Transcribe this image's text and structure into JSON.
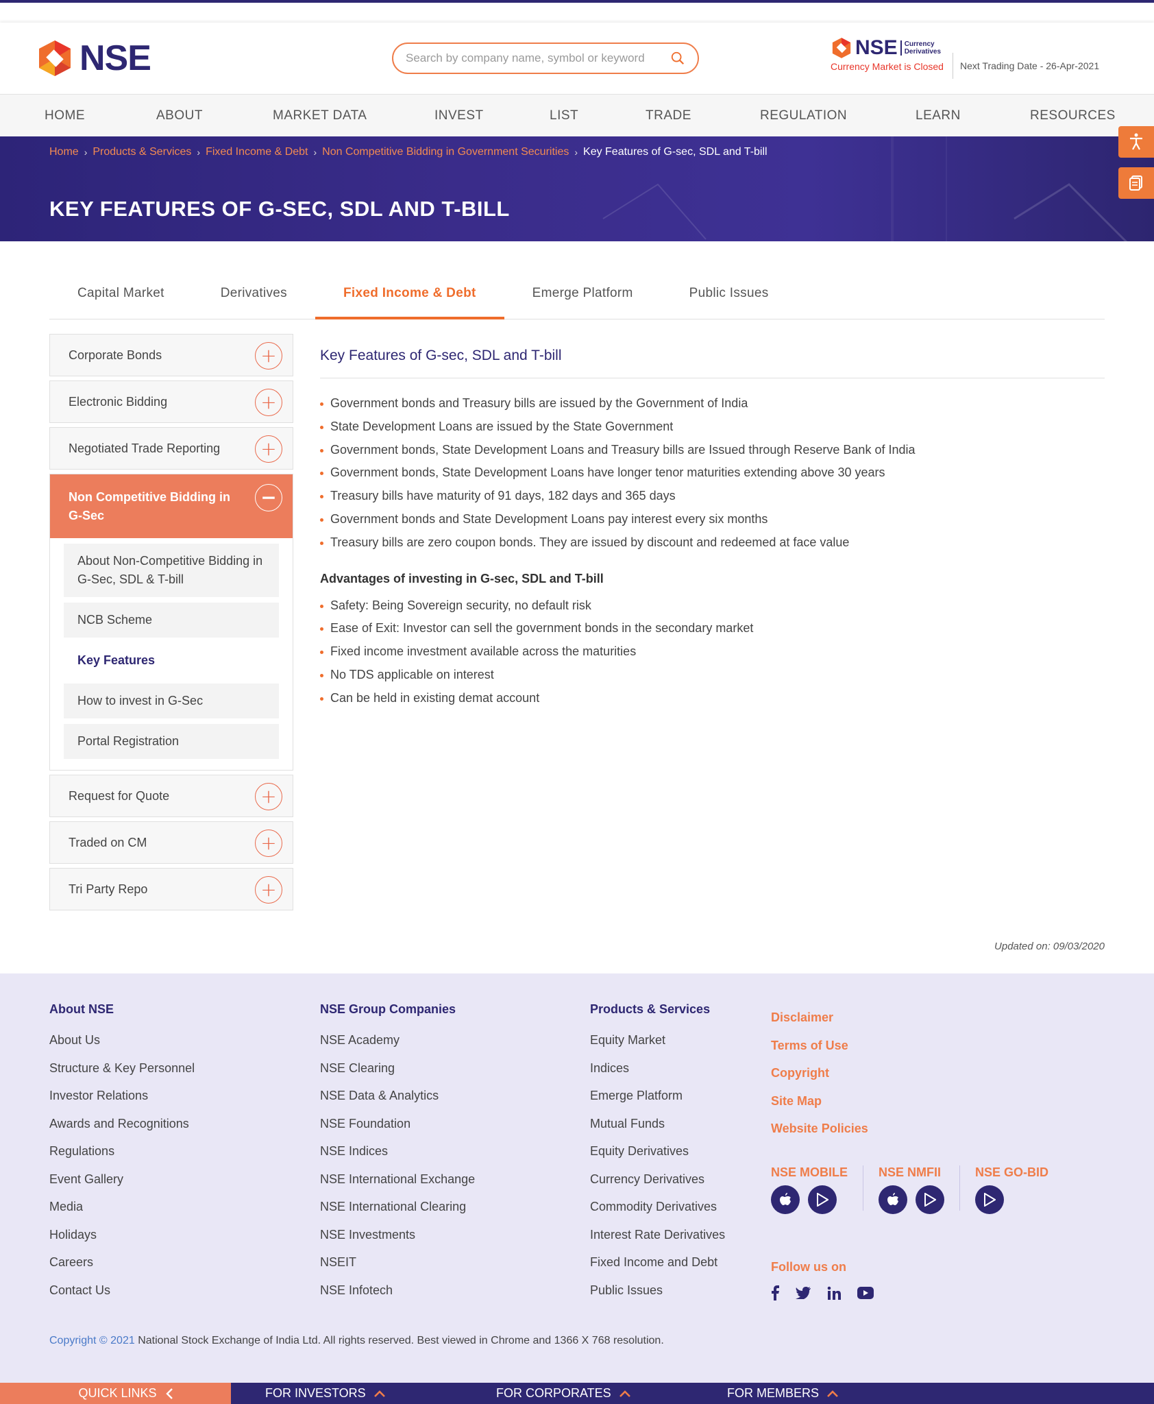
{
  "header": {
    "logo_text": "NSE",
    "search_placeholder": "Search by company name, symbol or keyword",
    "cd_logo": "NSE",
    "cd_sub_1": "Currency",
    "cd_sub_2": "Derivatives",
    "cd_status": "Currency Market is Closed",
    "trade_date": "Next Trading Date - 26-Apr-2021"
  },
  "nav": [
    "HOME",
    "ABOUT",
    "MARKET DATA",
    "INVEST",
    "LIST",
    "TRADE",
    "REGULATION",
    "LEARN",
    "RESOURCES"
  ],
  "breadcrumb": {
    "items": [
      "Home",
      "Products & Services",
      "Fixed Income & Debt",
      "Non Competitive Bidding in Government Securities"
    ],
    "current": "Key Features of G-sec, SDL and T-bill"
  },
  "page_title": "KEY FEATURES OF G-SEC, SDL AND T-BILL",
  "tabs": [
    "Capital Market",
    "Derivatives",
    "Fixed Income & Debt",
    "Emerge Platform",
    "Public Issues"
  ],
  "sidebar": {
    "top_items": [
      "Corporate Bonds",
      "Electronic Bidding",
      "Negotiated Trade Reporting"
    ],
    "open_item": "Non Competitive Bidding in G-Sec",
    "sub_items": [
      "About Non-Competitive Bidding in G-Sec, SDL & T-bill",
      "NCB Scheme",
      "Key Features",
      "How to invest in G-Sec",
      "Portal Registration"
    ],
    "bottom_items": [
      "Request for Quote",
      "Traded on CM",
      "Tri Party Repo"
    ]
  },
  "content": {
    "heading": "Key Features of G-sec, SDL and T-bill",
    "features": [
      "Government bonds and Treasury bills are issued by the Government of India",
      "State Development Loans are issued by the State Government",
      "Government bonds, State Development Loans and Treasury bills are Issued through Reserve Bank of India",
      "Government bonds, State Development Loans have longer tenor maturities extending above 30 years",
      "Treasury bills have maturity of 91 days, 182 days and 365 days",
      "Government bonds and State Development Loans pay interest every six months",
      "Treasury bills are zero coupon bonds. They are issued by discount and redeemed at face value"
    ],
    "advantages_heading": "Advantages of investing in G-sec, SDL and T-bill",
    "advantages": [
      "Safety: Being Sovereign security, no default risk",
      "Ease of Exit: Investor can sell the government bonds in the secondary market",
      "Fixed income investment available across the maturities",
      "No TDS applicable on interest",
      "Can be held in existing demat account"
    ],
    "updated": "Updated on: 09/03/2020"
  },
  "footer": {
    "about": {
      "title": "About NSE",
      "links": [
        "About Us",
        "Structure & Key Personnel",
        "Investor Relations",
        "Awards and Recognitions",
        "Regulations",
        "Event Gallery",
        "Media",
        "Holidays",
        "Careers",
        "Contact Us"
      ]
    },
    "group": {
      "title": "NSE Group Companies",
      "links": [
        "NSE Academy",
        "NSE Clearing",
        "NSE Data & Analytics",
        "NSE Foundation",
        "NSE Indices",
        "NSE International Exchange",
        "NSE International Clearing",
        "NSE Investments",
        "NSEIT",
        "NSE Infotech"
      ]
    },
    "products": {
      "title": "Products & Services",
      "links": [
        "Equity Market",
        "Indices",
        "Emerge Platform",
        "Mutual Funds",
        "Equity Derivatives",
        "Currency Derivatives",
        "Commodity Derivatives",
        "Interest Rate Derivatives",
        "Fixed Income and Debt",
        "Public Issues"
      ]
    },
    "legal": [
      "Disclaimer",
      "Terms of Use",
      "Copyright",
      "Site Map",
      "Website Policies"
    ],
    "apps": [
      "NSE MOBILE",
      "NSE NMFII",
      "NSE GO-BID"
    ],
    "follow": "Follow us on",
    "copyright_a": "Copyright © 2021",
    "copyright_b": "National Stock Exchange of India Ltd. All rights reserved. Best viewed in Chrome and 1366 X 768 resolution."
  },
  "bottombar": [
    "QUICK LINKS",
    "FOR INVESTORS",
    "FOR CORPORATES",
    "FOR MEMBERS"
  ],
  "colors": {
    "brand": "#2e2772",
    "accent": "#ef6d2c",
    "sidebar_open": "#ec7d5c"
  }
}
